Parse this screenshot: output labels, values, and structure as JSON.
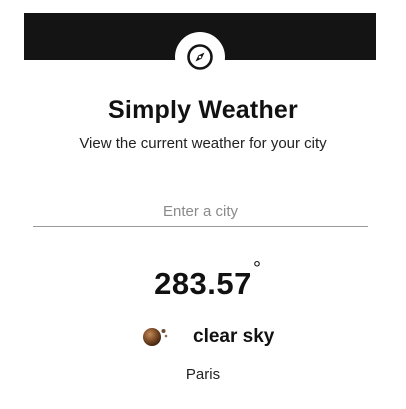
{
  "header": {
    "logo_icon": "compass-icon",
    "bar_color": "#141414"
  },
  "app": {
    "title": "Simply Weather",
    "subtitle": "View the current weather for your city"
  },
  "search": {
    "value": "",
    "placeholder": "Enter a city"
  },
  "weather": {
    "temperature": "283.57",
    "degree_symbol": "°",
    "condition_icon": "clear-sky-icon",
    "condition": "clear sky",
    "city": "Paris"
  }
}
